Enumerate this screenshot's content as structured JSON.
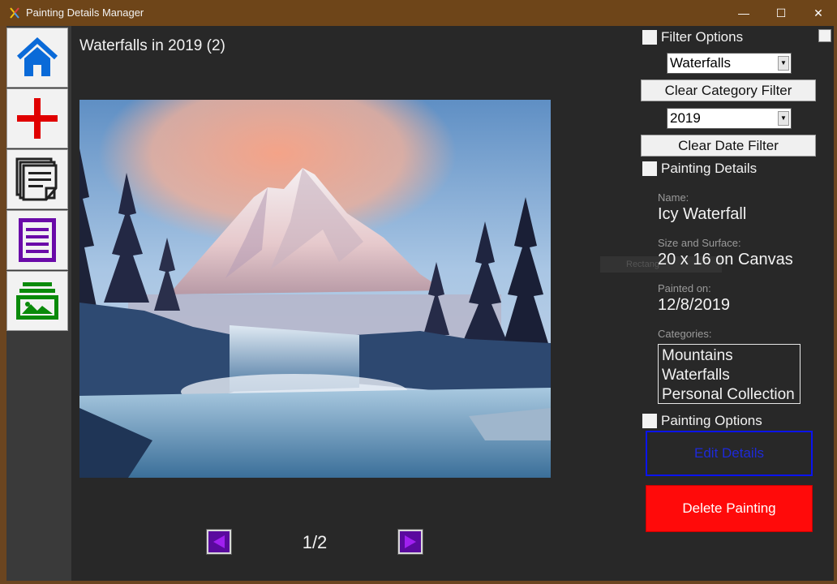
{
  "window": {
    "title": "Painting Details Manager",
    "controls": {
      "minimize": "—",
      "maximize": "☐",
      "close": "✕"
    }
  },
  "sidebar": {
    "items": [
      {
        "icon": "home-icon",
        "color": "#0a6ad8"
      },
      {
        "icon": "add-icon",
        "color": "#e00000"
      },
      {
        "icon": "documents-icon",
        "color": "#222222"
      },
      {
        "icon": "list-icon",
        "color": "#6a0aa8"
      },
      {
        "icon": "gallery-icon",
        "color": "#0a8a0a"
      }
    ]
  },
  "main": {
    "heading": "Waterfalls in 2019 (2)",
    "pager": {
      "current": "1/2"
    },
    "ghost_label": "Rectang"
  },
  "filter_options": {
    "header": "Filter Options",
    "category_select": "Waterfalls",
    "clear_category": "Clear Category Filter",
    "date_select": "2019",
    "clear_date": "Clear Date Filter"
  },
  "painting_details": {
    "header": "Painting Details",
    "name_label": "Name:",
    "name_value": "Icy Waterfall",
    "size_label": "Size and Surface:",
    "size_value": "20 x 16 on Canvas",
    "painted_label": "Painted on:",
    "painted_value": "12/8/2019",
    "categories_label": "Categories:",
    "categories": [
      "Mountains",
      "Waterfalls",
      "Personal Collection"
    ]
  },
  "painting_options": {
    "header": "Painting Options",
    "edit": "Edit Details",
    "delete": "Delete Painting"
  },
  "colors": {
    "accent_purple": "#5a0a9e",
    "delete_red": "#ff0a0a",
    "edit_blue": "#0a14f0"
  }
}
